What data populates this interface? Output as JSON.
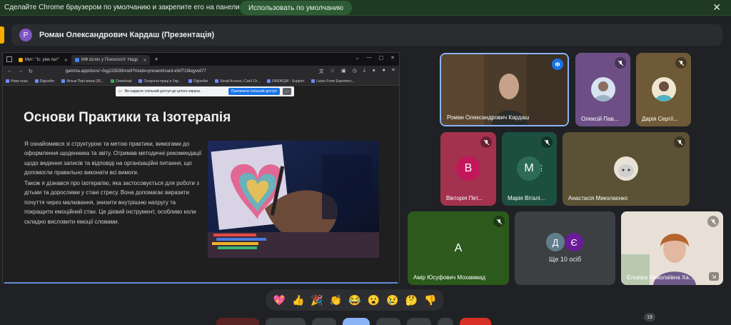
{
  "banner": {
    "message": "Сделайте Chrome браузером по умолчанию и закрепите его на панели задач.",
    "button_label": "Использовать по умолчанию",
    "close_glyph": "✕"
  },
  "presenter": {
    "avatar_letter": "P",
    "title": "Роман Олександрович Кардаш (Презентація)"
  },
  "shared_browser": {
    "tabs": [
      {
        "label": "Мит: \"Іс: уінк пат\"",
        "active": false
      },
      {
        "label": "МФ Шлях у Психології: Надр",
        "active": true
      }
    ],
    "new_tab_glyph": "+",
    "url": "gamma.app/docs/~0qg22i5i39nrw9?mode=present#card-e5rf719kqyvtd77",
    "bookmarks": [
      "Нова пока",
      "Digiseller",
      "Фільм Пері жінки (20...",
      "Download",
      "Охоронні праці в Укр...",
      "Digiseller",
      "Email Access | CarX Dr...",
      "FA50KQM - Support",
      "Learn From Experienc..."
    ],
    "share_notice": {
      "text": "Ви надаєте спільний доступ до цілого екрана.",
      "stop_label": "Припинити спільний доступ",
      "more_label": "..."
    }
  },
  "slide": {
    "title": "Основи Практики та Ізотерапія",
    "paragraph_1": "Я ознайомився зі структурою та метою практики, вимогами до оформлення щоденника та звіту. Отримав методичні рекомендації щодо ведення записів та відповіді на організаційні питання, що допомогли правильно виконати всі вимоги.",
    "paragraph_2": "Також я дізнався про ізотерапію, яка застосовується для роботи з дітьми та дорослими у стані стресу. Вона допомагає виразити почуття через малювання, знизити внутрішню напругу та покращити емоційний стан. Це дієвий інструмент, особливо коли складно висловити емоції словами."
  },
  "participants": [
    {
      "name": "Роман Олександрович Кардаш",
      "kind": "video",
      "speaking": true
    },
    {
      "name": "Олексій Пав...",
      "kind": "avatar-photo",
      "muted": true
    },
    {
      "name": "Дарія Сергії...",
      "kind": "avatar-photo",
      "muted": true
    },
    {
      "name": "Вікторія Пет...",
      "kind": "letter",
      "letter": "В",
      "color": "#c2185b",
      "muted": true
    },
    {
      "name": "Марія Віталі...",
      "kind": "letter",
      "letter": "М",
      "color": "#1e5e4a",
      "muted": true
    },
    {
      "name": "Анастасія Миколаєнко",
      "kind": "avatar-photo",
      "muted": true
    },
    {
      "name": "Амір Юсуфович Мохаммад",
      "kind": "letter",
      "letter": "А",
      "color": "#2e5a1d",
      "muted": true
    },
    {
      "name": "Ще 10 осіб",
      "kind": "group",
      "letters": [
        "Д",
        "Є"
      ]
    },
    {
      "name": "Ельвіра Миколаївна Ха...",
      "kind": "video",
      "muted": true
    }
  ],
  "reactions": [
    "💖",
    "👍",
    "🎉",
    "👏",
    "😂",
    "😮",
    "😢",
    "🤔",
    "👎"
  ],
  "people_count": "19",
  "colors": {
    "accent": "#8ab4f8",
    "banner_bg": "#1e3a22",
    "meet_bg": "#202124"
  }
}
